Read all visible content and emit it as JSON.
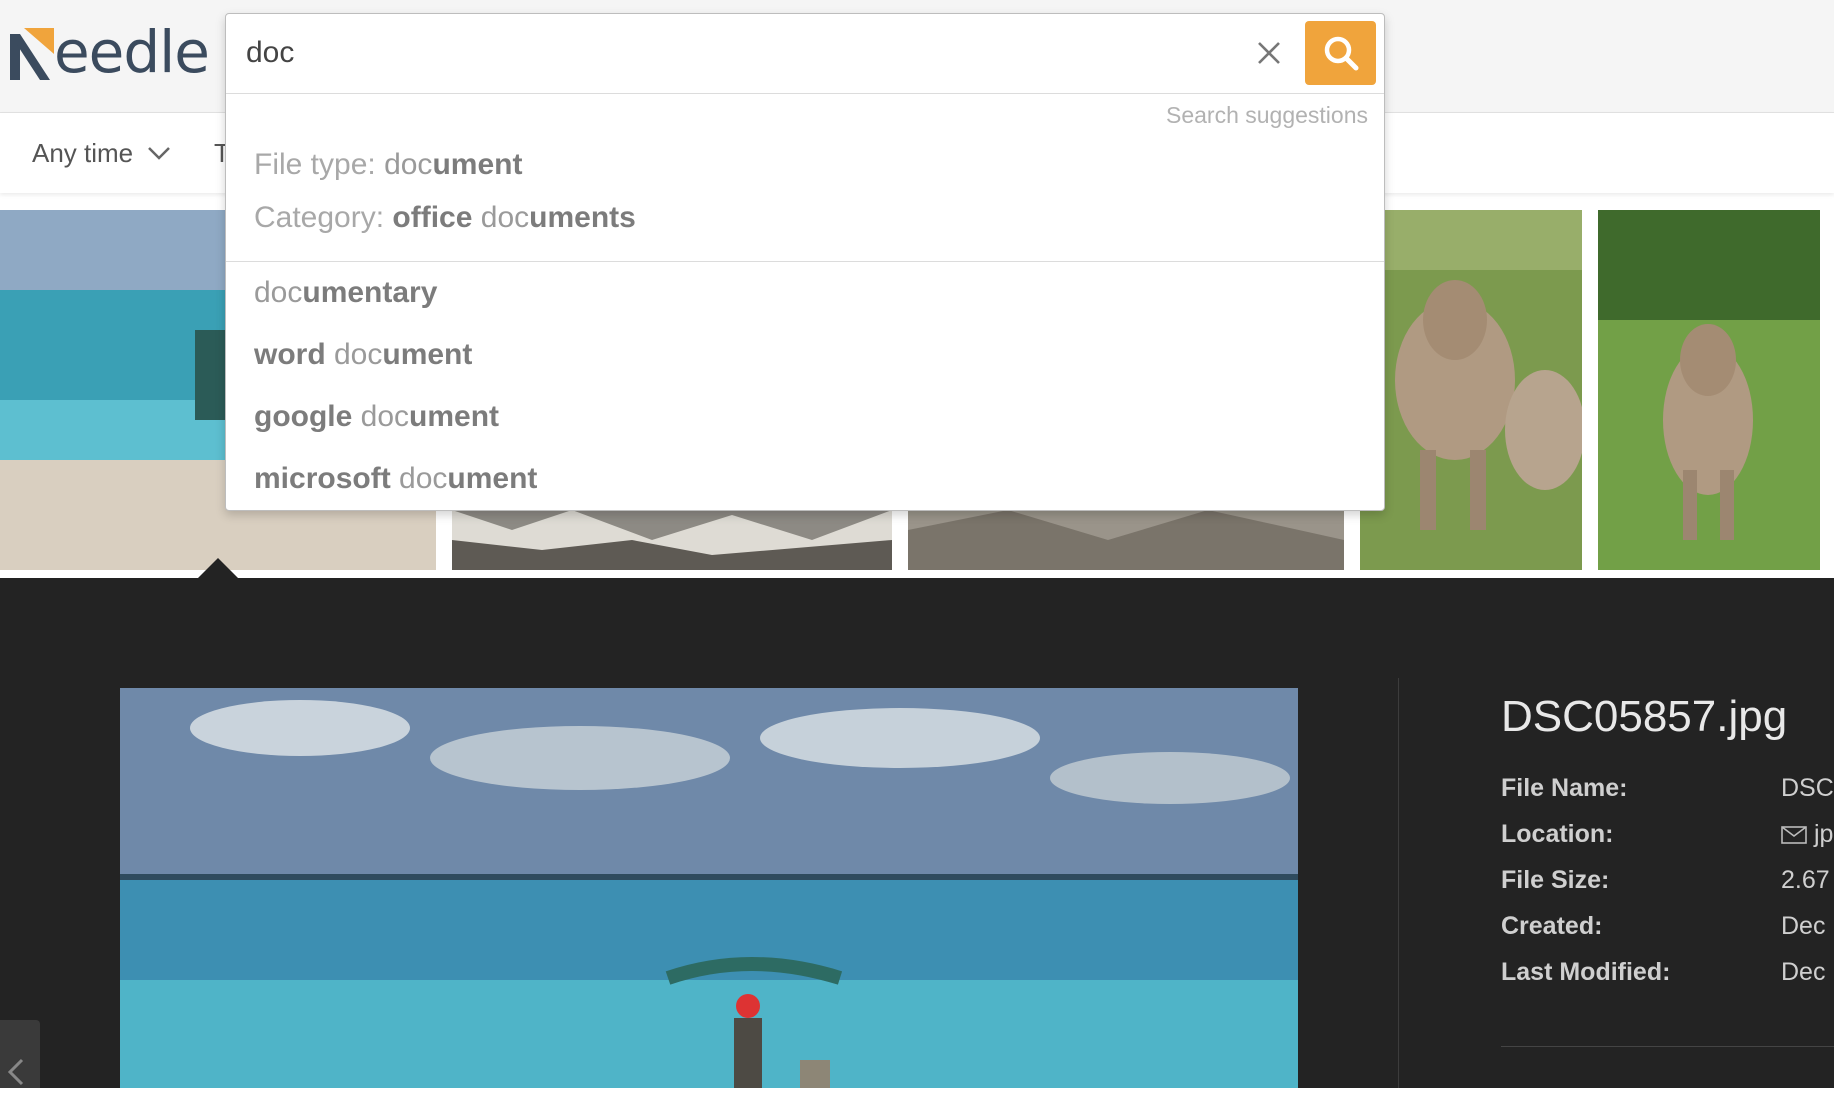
{
  "app": {
    "logo_text": "eedle",
    "logo_alt": "Needle",
    "brand_color": "#f0a43c"
  },
  "search": {
    "value": "doc",
    "placeholder": "",
    "suggestions_caption": "Search suggestions",
    "typed_suggestions": [
      {
        "prefix": "File type: ",
        "match": "doc",
        "rest": "ument"
      },
      {
        "prefix": "Category: ",
        "lead": "office ",
        "match": "doc",
        "rest": "uments"
      }
    ],
    "suggestions": [
      {
        "lead": "",
        "match": "doc",
        "rest": "umentary"
      },
      {
        "lead": "word ",
        "match": "doc",
        "rest": "ument"
      },
      {
        "lead": "google ",
        "match": "doc",
        "rest": "ument"
      },
      {
        "lead": "microsoft ",
        "match": "doc",
        "rest": "ument"
      }
    ]
  },
  "filters": {
    "time_label": "Any time",
    "second_label": "T"
  },
  "detail": {
    "title": "DSC05857.jpg",
    "fields": [
      {
        "label": "File Name:",
        "value": "DSC"
      },
      {
        "label": "Location:",
        "value": "jp"
      },
      {
        "label": "File Size:",
        "value": "2.67"
      },
      {
        "label": "Created:",
        "value": "Dec"
      },
      {
        "label": "Last Modified:",
        "value": "Dec"
      }
    ]
  }
}
